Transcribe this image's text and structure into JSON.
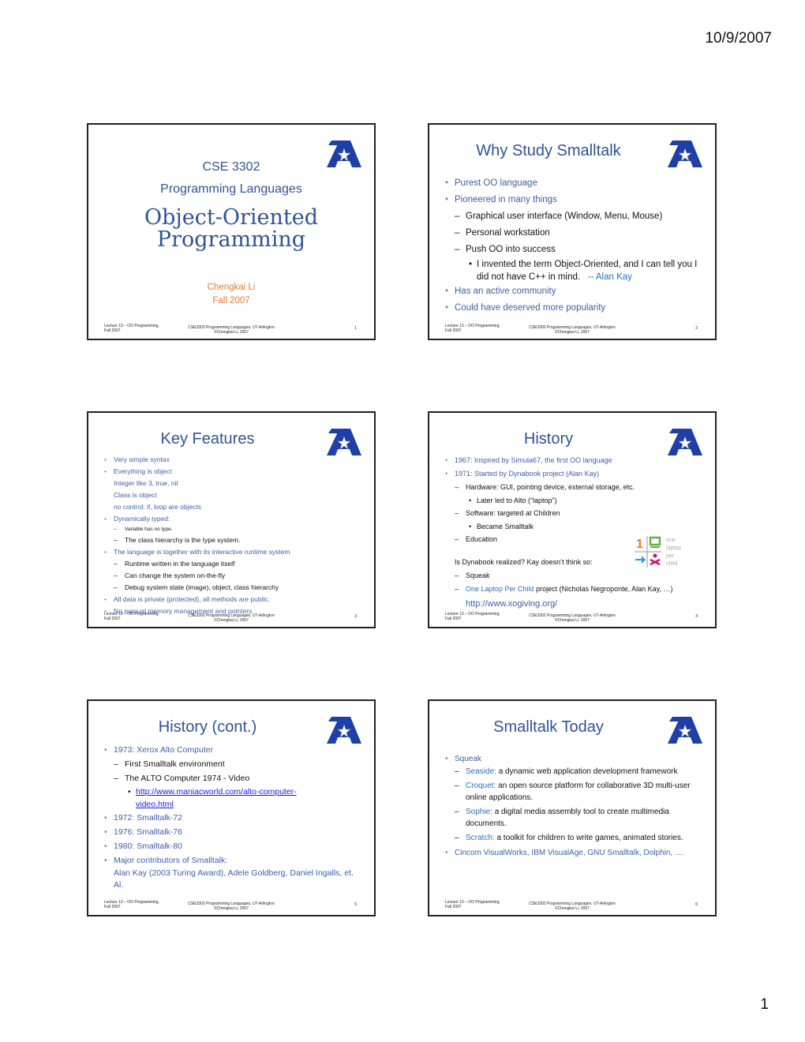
{
  "page": {
    "date": "10/9/2007",
    "number": "1"
  },
  "footer": {
    "left": "Lecture 13 – OO Programming, Fall 2007",
    "left_line1": "Lecture 13 – OO Programming,",
    "left_line2": "Fall 2007",
    "mid_line1": "CSE3302 Programming Languages, UT-Arlington",
    "mid_line2": "©Chengkai Li, 2007"
  },
  "colors": {
    "title_blue": "#2e5495",
    "accent_orange": "#e6792c",
    "link_blue": "#1a1aee",
    "logo_blue": "#1f3fa8"
  },
  "logo": {
    "icon": "ut-arlington-logo"
  },
  "slides": [
    {
      "number": "1",
      "course": "CSE 3302",
      "course_name": "Programming Languages",
      "title_line1": "Object-Oriented",
      "title_line2": "Programming",
      "author": "Chengkai Li",
      "term": "Fall 2007"
    },
    {
      "number": "2",
      "title": "Why Study Smalltalk",
      "items": [
        "Purest OO language",
        "Pioneered in many things",
        "Graphical user interface (Window, Menu, Mouse)",
        "Personal workstation",
        "Push OO into success",
        "I invented the term Object-Oriented, and I can tell you I did not have C++ in mind.",
        "-- Alan Kay",
        "Has an active community",
        "Could have deserved more popularity"
      ]
    },
    {
      "number": "3",
      "title": "Key Features",
      "items": [
        "Very simple syntax",
        "Everything is object",
        "Integer like 3, true, nil",
        "Class is object",
        "no control: if, loop are objects",
        "Dynamically typed:",
        "Variable has no type.",
        "The class hierarchy is the type system.",
        "The language is together with its interactive runtime system",
        "Runtime written in the language itself",
        "Can change the system on-the-fly",
        "Debug system state (image), object, class hierarchy",
        "All data is private (protected), all methods are public.",
        "No manual memory management and pointers"
      ]
    },
    {
      "number": "4",
      "title": "History",
      "items": [
        "1967:  Inspired by Simula67, the first OO language",
        "1971: Started by Dynabook project (Alan Kay)",
        "Hardware: GUI, pointing device, external storage, etc.",
        "Later led to Alto (“laptop”)",
        "Software: targeted at Children",
        "Became Smalltalk",
        "Education",
        "Is Dynabook realized? Kay doesn’t think so:",
        "Squeak",
        "One Laptop Per Child",
        " project (Nicholas Negroponte, Alan Kay, …)",
        "http://www.xogiving.org/"
      ],
      "olpc_logo": {
        "line1": "one",
        "line2": "laptop",
        "line3": "per",
        "line4": "child",
        "numeral": "1"
      }
    },
    {
      "number": "5",
      "title": "History (cont.)",
      "items": [
        "1973: Xerox Alto Computer",
        "First Smalltalk environment",
        "The ALTO Computer 1974 - Video",
        "http://www.maniacworld.com/alto-computer-",
        "video.html",
        "1972: Smalltalk-72",
        "1976: Smalltalk-76",
        "1980: Smalltalk-80",
        "Major contributors of Smalltalk:",
        "Alan Kay (2003 Turing Award), Adele Goldberg, Daniel Ingalls, et. Al."
      ]
    },
    {
      "number": "6",
      "title": "Smalltalk Today",
      "items": [
        "Squeak",
        "Seaside:",
        " a dynamic web application development framework",
        "Croquet:",
        " an open source platform for collaborative 3D multi-user online applications.",
        "Sophie:",
        " a digital media assembly tool to create multimedia documents.",
        "Scratch:",
        " a toolkit for children to write games, animated stories.",
        "Cincom VisualWorks, IBM VisualAge, GNU Smalltalk, Dolphin, ...."
      ]
    }
  ]
}
